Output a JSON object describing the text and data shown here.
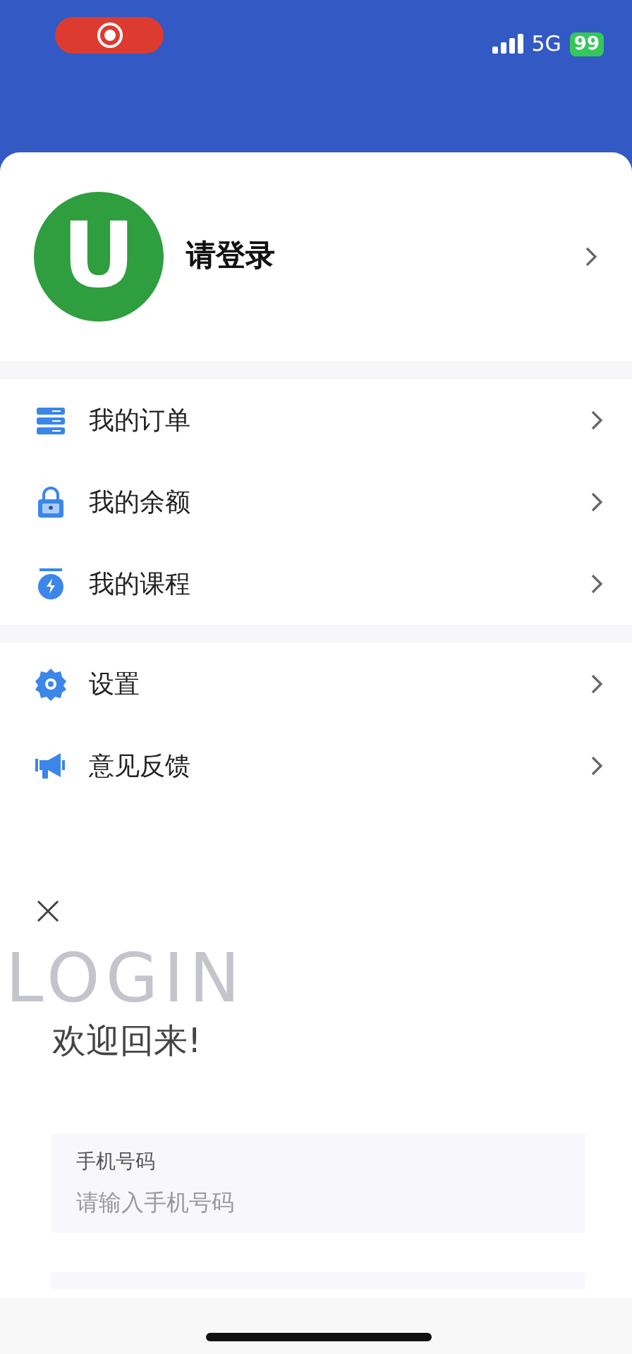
{
  "status_bar": {
    "network": "5G",
    "battery": "99"
  },
  "profile": {
    "title": "请登录",
    "avatar_letter": "U"
  },
  "menu_groups": [
    {
      "items": [
        {
          "label": "我的订单"
        },
        {
          "label": "我的余额"
        },
        {
          "label": "我的课程"
        }
      ]
    },
    {
      "items": [
        {
          "label": "设置"
        },
        {
          "label": "意见反馈"
        }
      ]
    }
  ],
  "login": {
    "background_word": "LOGIN",
    "heading": "欢迎回来!",
    "fields": [
      {
        "label": "手机号码",
        "placeholder": "请输入手机号码"
      }
    ]
  }
}
